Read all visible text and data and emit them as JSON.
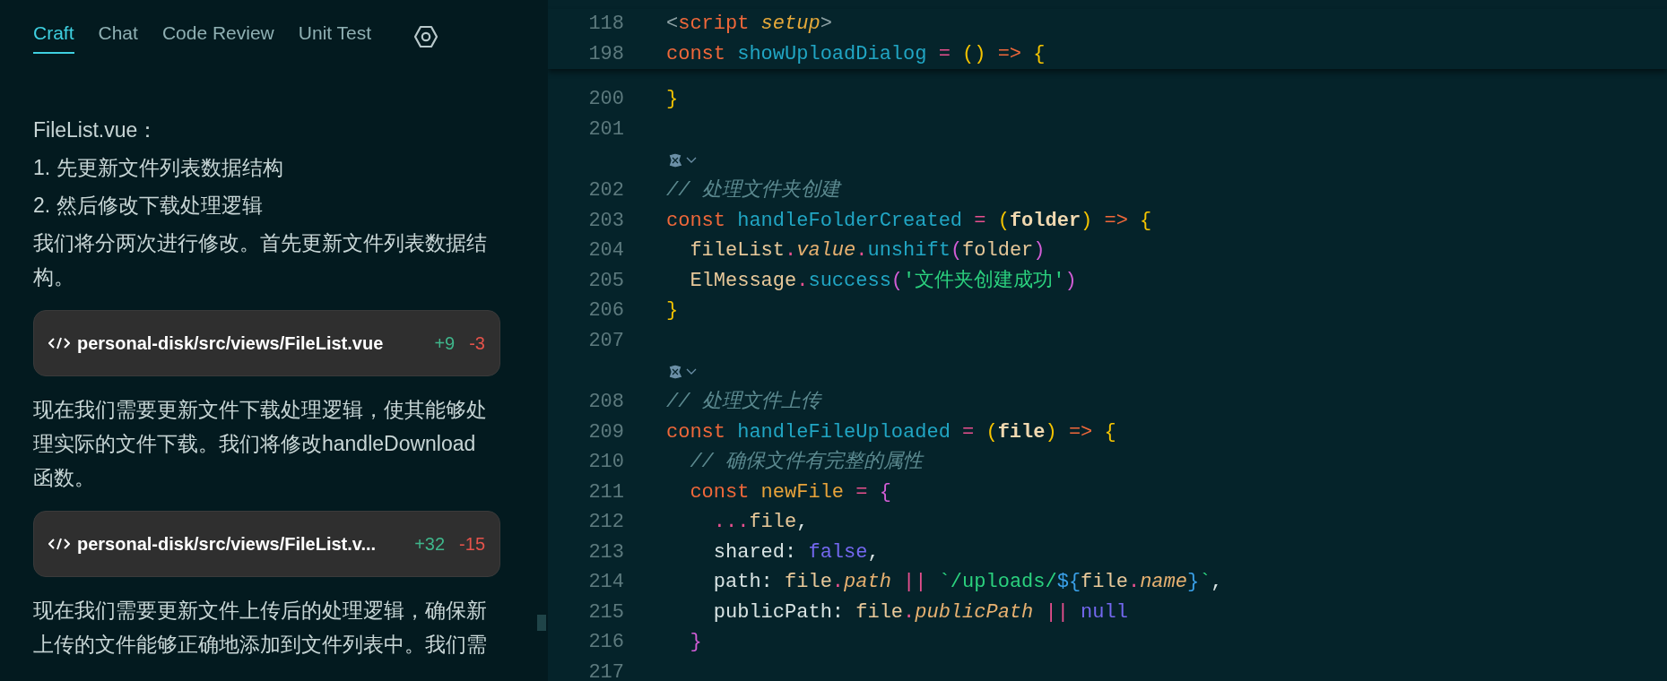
{
  "tabs": [
    {
      "label": "Craft",
      "selected": true
    },
    {
      "label": "Chat",
      "selected": false
    },
    {
      "label": "Code Review",
      "selected": false
    },
    {
      "label": "Unit Test",
      "selected": false
    }
  ],
  "chat": [
    {
      "kind": "text",
      "text": "FileList.vue："
    },
    {
      "kind": "text",
      "text": "1. 先更新文件列表数据结构"
    },
    {
      "kind": "text",
      "text": "2. 然后修改下载处理逻辑"
    },
    {
      "kind": "text",
      "text": "我们将分两次进行修改。首先更新文件列表数据结构。"
    },
    {
      "kind": "file",
      "path": "personal-disk/src/views/FileList.vue",
      "added": "+9",
      "removed": "-3"
    },
    {
      "kind": "text",
      "text": "现在我们需要更新文件下载处理逻辑，使其能够处理实际的文件下载。我们将修改handleDownload函数。"
    },
    {
      "kind": "file",
      "path": "personal-disk/src/views/FileList.v...",
      "added": "+32",
      "removed": "-15"
    },
    {
      "kind": "text",
      "text": "现在我们需要更新文件上传后的处理逻辑，确保新上传的文件能够正确地添加到文件列表中。我们需"
    }
  ],
  "sticky_lines": [
    {
      "number": "118",
      "tokens": [
        {
          "text": "<",
          "kind": "tag"
        },
        {
          "text": "script",
          "kind": "tagname"
        },
        {
          "text": " setup",
          "kind": "attr"
        },
        {
          "text": ">",
          "kind": "tag"
        }
      ]
    },
    {
      "number": "198",
      "tokens": [
        {
          "text": "const",
          "kind": "kw"
        },
        {
          "text": " showUploadDialog",
          "kind": "fn"
        },
        {
          "text": " =",
          "kind": "op"
        },
        {
          "text": " ()",
          "kind": "brace"
        },
        {
          "text": " =>",
          "kind": "kw"
        },
        {
          "text": " {",
          "kind": "brace"
        }
      ]
    }
  ],
  "lines": [
    {
      "kind": "line",
      "number": "200",
      "tokens": [
        {
          "text": "}",
          "kind": "brace"
        }
      ]
    },
    {
      "kind": "line",
      "number": "201"
    },
    {
      "kind": "codelens"
    },
    {
      "kind": "line",
      "number": "202",
      "tokens": [
        {
          "text": "// 处理文件夹创建",
          "kind": "comment"
        }
      ]
    },
    {
      "kind": "line",
      "number": "203",
      "tokens": [
        {
          "text": "const",
          "kind": "kw"
        },
        {
          "text": " handleFolderCreated",
          "kind": "fn"
        },
        {
          "text": " =",
          "kind": "op"
        },
        {
          "text": " (",
          "kind": "brace"
        },
        {
          "text": "folder",
          "kind": "param"
        },
        {
          "text": ")",
          "kind": "brace"
        },
        {
          "text": " =>",
          "kind": "kw"
        },
        {
          "text": " {",
          "kind": "brace"
        }
      ]
    },
    {
      "kind": "line",
      "number": "204",
      "tokens": [
        {
          "text": "  fileList",
          "kind": "var"
        },
        {
          "text": ".",
          "kind": "op"
        },
        {
          "text": "value",
          "kind": "italic"
        },
        {
          "text": ".",
          "kind": "op"
        },
        {
          "text": "unshift",
          "kind": "fn"
        },
        {
          "text": "(",
          "kind": "paren"
        },
        {
          "text": "folder",
          "kind": "var"
        },
        {
          "text": ")",
          "kind": "paren"
        }
      ]
    },
    {
      "kind": "line",
      "number": "205",
      "tokens": [
        {
          "text": "  ElMessage",
          "kind": "var"
        },
        {
          "text": ".",
          "kind": "op"
        },
        {
          "text": "success",
          "kind": "fn"
        },
        {
          "text": "(",
          "kind": "paren"
        },
        {
          "text": "'文件夹创建成功'",
          "kind": "str"
        },
        {
          "text": ")",
          "kind": "paren"
        }
      ]
    },
    {
      "kind": "line",
      "number": "206",
      "tokens": [
        {
          "text": "}",
          "kind": "brace"
        }
      ]
    },
    {
      "kind": "line",
      "number": "207"
    },
    {
      "kind": "codelens"
    },
    {
      "kind": "line",
      "number": "208",
      "tokens": [
        {
          "text": "// 处理文件上传",
          "kind": "comment"
        }
      ]
    },
    {
      "kind": "line",
      "number": "209",
      "tokens": [
        {
          "text": "const",
          "kind": "kw"
        },
        {
          "text": " handleFileUploaded",
          "kind": "fn"
        },
        {
          "text": " =",
          "kind": "op"
        },
        {
          "text": " (",
          "kind": "brace"
        },
        {
          "text": "file",
          "kind": "param"
        },
        {
          "text": ")",
          "kind": "brace"
        },
        {
          "text": " =>",
          "kind": "kw"
        },
        {
          "text": " {",
          "kind": "brace"
        }
      ]
    },
    {
      "kind": "line",
      "number": "210",
      "tokens": [
        {
          "text": "  // 确保文件有完整的属性",
          "kind": "comment"
        }
      ]
    },
    {
      "kind": "line",
      "number": "211",
      "tokens": [
        {
          "text": "  const",
          "kind": "kw"
        },
        {
          "text": " newFile",
          "kind": "newvar"
        },
        {
          "text": " =",
          "kind": "op"
        },
        {
          "text": " {",
          "kind": "paren"
        }
      ]
    },
    {
      "kind": "line",
      "number": "212",
      "tokens": [
        {
          "text": "    ...",
          "kind": "op"
        },
        {
          "text": "file",
          "kind": "var"
        },
        {
          "text": ",",
          "kind": "prop"
        }
      ]
    },
    {
      "kind": "line",
      "number": "213",
      "tokens": [
        {
          "text": "    shared: ",
          "kind": "prop"
        },
        {
          "text": "false",
          "kind": "const"
        },
        {
          "text": ",",
          "kind": "prop"
        }
      ]
    },
    {
      "kind": "line",
      "number": "214",
      "tokens": [
        {
          "text": "    path: ",
          "kind": "prop"
        },
        {
          "text": "file",
          "kind": "var"
        },
        {
          "text": ".",
          "kind": "op"
        },
        {
          "text": "path",
          "kind": "italic"
        },
        {
          "text": " ||",
          "kind": "op"
        },
        {
          "text": " `/uploads/",
          "kind": "str"
        },
        {
          "text": "${",
          "kind": "interp"
        },
        {
          "text": "file",
          "kind": "var"
        },
        {
          "text": ".",
          "kind": "op"
        },
        {
          "text": "name",
          "kind": "italic"
        },
        {
          "text": "}",
          "kind": "interp"
        },
        {
          "text": "`",
          "kind": "str"
        },
        {
          "text": ",",
          "kind": "prop"
        }
      ]
    },
    {
      "kind": "line",
      "number": "215",
      "tokens": [
        {
          "text": "    publicPath: ",
          "kind": "prop"
        },
        {
          "text": "file",
          "kind": "var"
        },
        {
          "text": ".",
          "kind": "op"
        },
        {
          "text": "publicPath",
          "kind": "italic"
        },
        {
          "text": " ||",
          "kind": "op"
        },
        {
          "text": " null",
          "kind": "const"
        }
      ]
    },
    {
      "kind": "line",
      "number": "216",
      "tokens": [
        {
          "text": "  }",
          "kind": "paren"
        }
      ]
    },
    {
      "kind": "line",
      "number": "217"
    }
  ]
}
